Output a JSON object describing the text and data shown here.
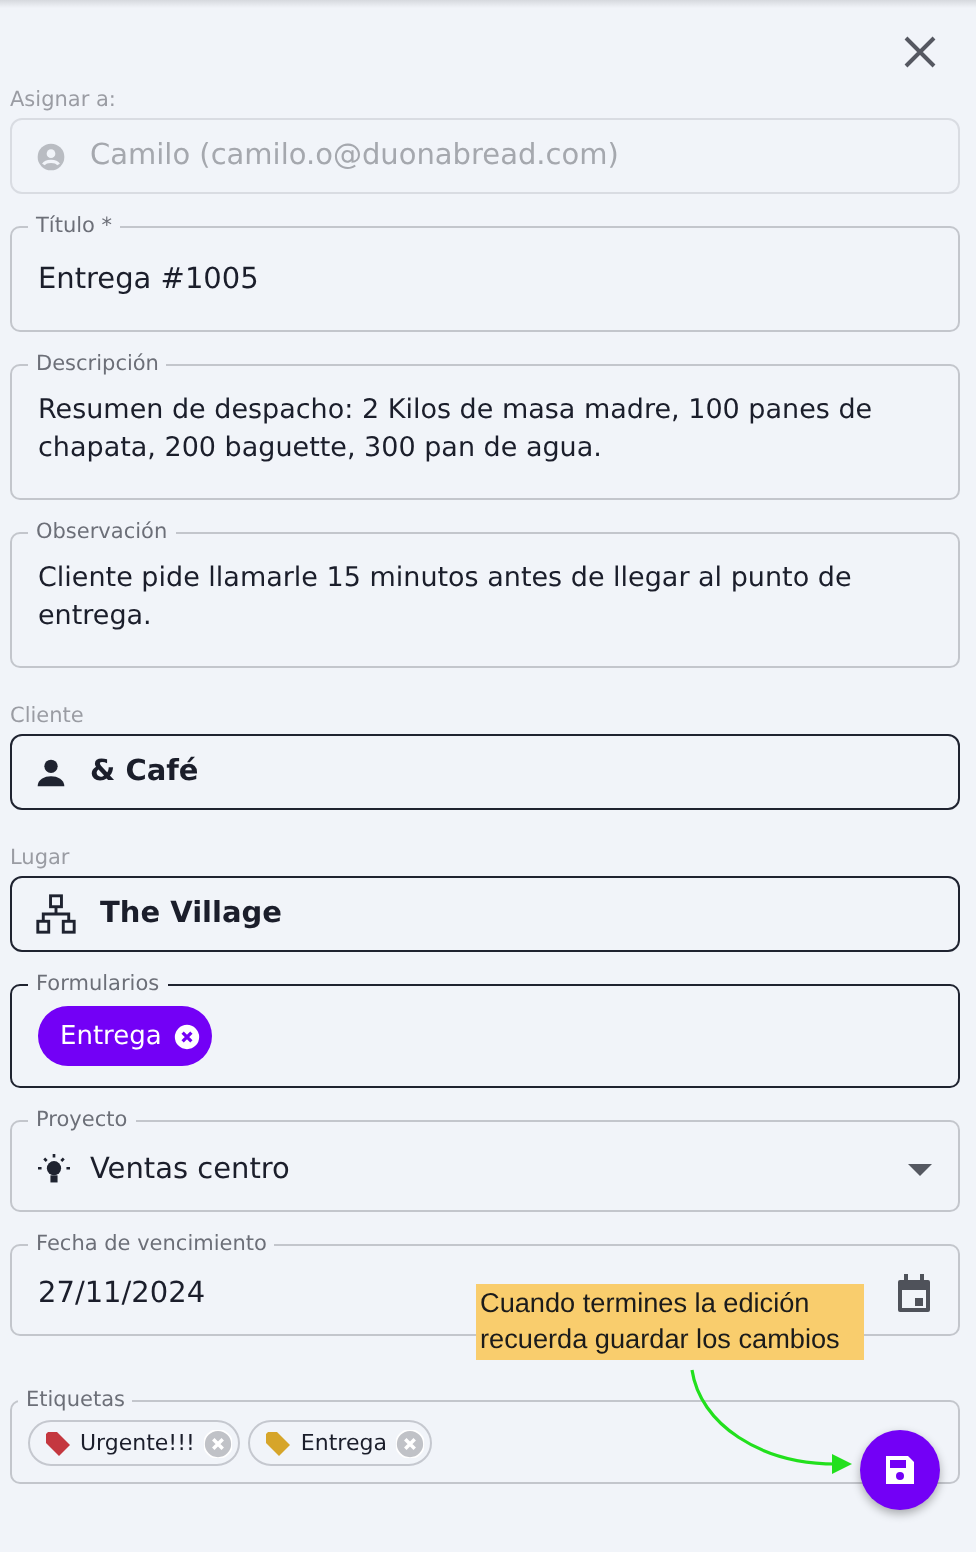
{
  "fields": [
    {
      "kind": "assignee",
      "label": "Asignar a:",
      "value": "Camilo (camilo.o@duonabread.com)",
      "disabled": true
    },
    {
      "kind": "text",
      "label": "Título *",
      "value": "Entrega #1005"
    },
    {
      "kind": "multiline",
      "label": "Descripción",
      "value": "Resumen de despacho: 2 Kilos de masa madre, 100 panes de chapata, 200 baguette, 300 pan de agua."
    },
    {
      "kind": "multiline",
      "label": "Observación",
      "value": "Cliente pide llamarle 15 minutos antes de llegar al punto de entrega."
    },
    {
      "kind": "client",
      "label": "Cliente",
      "value": "& Café"
    },
    {
      "kind": "place",
      "label": "Lugar",
      "value": "The Village"
    },
    {
      "kind": "chips",
      "label": "Formularios",
      "chips": [
        "Entrega"
      ]
    },
    {
      "kind": "select",
      "label": "Proyecto",
      "value": "Ventas centro"
    },
    {
      "kind": "date",
      "label": "Fecha de vencimiento",
      "value": "27/11/2024"
    },
    {
      "kind": "tags",
      "label": "Etiquetas",
      "tags": [
        {
          "label": "Urgente!!!",
          "color": "#c4373f"
        },
        {
          "label": "Entrega",
          "color": "#d6a52a"
        }
      ]
    }
  ],
  "note": "Cuando termines la edición recuerda guardar los cambios"
}
